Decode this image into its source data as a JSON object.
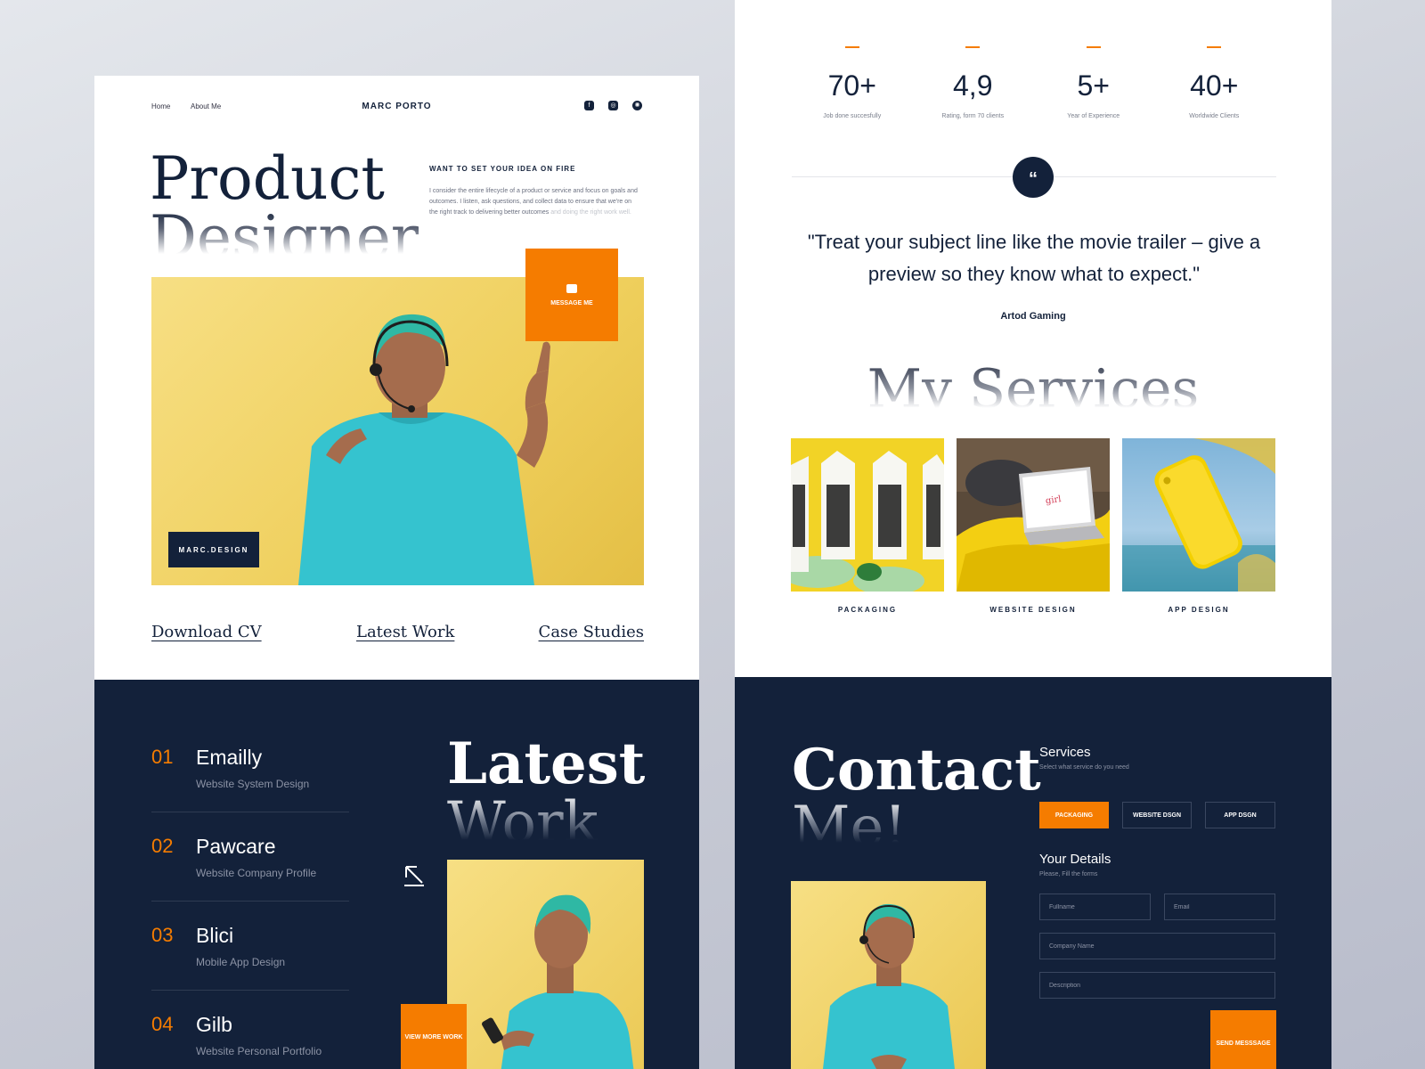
{
  "hero": {
    "nav": {
      "home": "Home",
      "about": "About Me",
      "brand": "MARC PORTO"
    },
    "title_line1": "Product",
    "title_line2": "Designer",
    "kicker": "WANT TO SET YOUR IDEA ON FIRE",
    "description_main": "I consider the entire lifecycle of a product or service and focus on goals and outcomes. I listen, ask questions, and collect data to ensure that we're on the right track to delivering better outcomes",
    "description_fade": "and doing the right work well.",
    "message_button": "MESSAGE ME",
    "badge": "MARC.DESIGN",
    "links": {
      "cv": "Download CV",
      "latest": "Latest Work",
      "cases": "Case Studies"
    }
  },
  "stats": [
    {
      "value": "70+",
      "label": "Job done succesfully"
    },
    {
      "value": "4,9",
      "label": "Rating, form 70 clients"
    },
    {
      "value": "5+",
      "label": "Year of Experience"
    },
    {
      "value": "40+",
      "label": "Worldwide Clients"
    }
  ],
  "testimonial": {
    "icon": "quote-icon",
    "quote": "\"Treat your subject line like the movie trailer – give a preview so they know what to expect.\"",
    "author": "Artod Gaming"
  },
  "services": {
    "title": "My Services",
    "items": [
      {
        "label": "PACKAGING"
      },
      {
        "label": "WEBSITE DESIGN"
      },
      {
        "label": "APP DESIGN"
      }
    ]
  },
  "works": {
    "title_line1": "Latest",
    "title_line2": "Work",
    "view_more": "VIEW MORE WORK",
    "items": [
      {
        "num": "01",
        "name": "Emailly",
        "sub": "Website System Design"
      },
      {
        "num": "02",
        "name": "Pawcare",
        "sub": "Website Company Profile"
      },
      {
        "num": "03",
        "name": "Blici",
        "sub": "Mobile App Design"
      },
      {
        "num": "04",
        "name": "Gilb",
        "sub": "Website Personal Portfolio"
      }
    ]
  },
  "contact": {
    "title_line1": "Contact",
    "title_line2": "Me!",
    "services_heading": "Services",
    "services_sub": "Select what service do you need",
    "service_options": [
      "PACKAGING",
      "WEBSITE DSGN",
      "APP DSGN"
    ],
    "details_heading": "Your Details",
    "details_sub": "Please, Fill the forms",
    "placeholders": {
      "fullname": "Fullname",
      "email": "Email",
      "company": "Company Name",
      "description": "Description"
    },
    "send_button": "SEND MESSSAGE"
  },
  "colors": {
    "accent": "#f57c00",
    "navy": "#13213a",
    "photo_bg": "#efcf5c"
  }
}
